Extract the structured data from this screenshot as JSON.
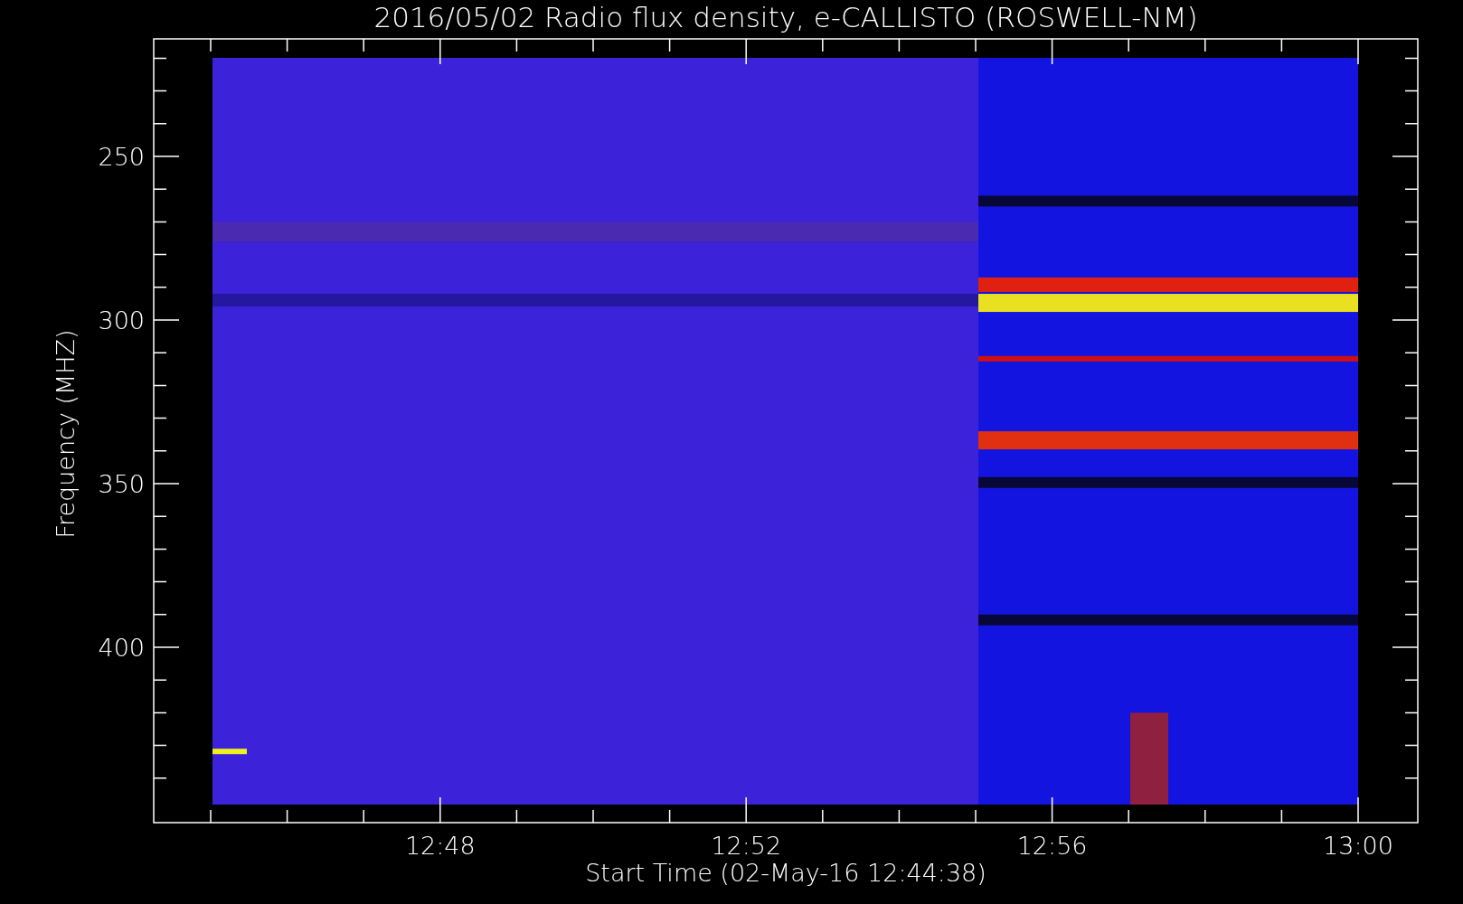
{
  "title": "2016/05/02  Radio flux density, e-CALLISTO (ROSWELL-NM)",
  "y_axis": {
    "label": "Frequency (MHZ)",
    "ticks": [
      "250",
      "300",
      "350",
      "400"
    ]
  },
  "x_axis": {
    "label": "Start Time (02-May-16 12:44:38)",
    "ticks": [
      "12:48",
      "12:52",
      "12:56",
      "13:00"
    ]
  }
}
